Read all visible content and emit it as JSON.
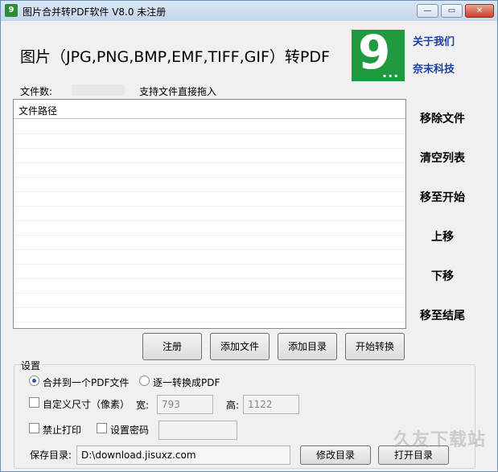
{
  "window": {
    "title": "图片合并转PDF软件 V8.0 未注册",
    "icon_text": "9",
    "controls": {
      "minimize": "—",
      "maximize": "▭",
      "close": "✕"
    }
  },
  "header": {
    "heading": "图片（JPG,PNG,BMP,EMF,TIFF,GIF）转PDF",
    "logo_text": "9",
    "logo_dots": "...",
    "about_link": "关于我们",
    "brand_link": "奈末科技"
  },
  "files": {
    "count_label": "文件数:",
    "count_value": "",
    "drag_hint": "支持文件直接拖入",
    "column_header": "文件路径",
    "rows": []
  },
  "side_actions": {
    "remove": "移除文件",
    "clear": "清空列表",
    "move_top": "移至开始",
    "move_up": "上移",
    "move_down": "下移",
    "move_bottom": "移至结尾"
  },
  "buttons": {
    "register": "注册",
    "add_file": "添加文件",
    "add_dir": "添加目录",
    "start": "开始转换"
  },
  "settings": {
    "title": "设置",
    "merge_option": "合并到一个PDF文件",
    "merge_selected": true,
    "each_option": "逐一转换成PDF",
    "custom_size_label": "自定义尺寸（像素）",
    "width_label": "宽:",
    "width_value": "793",
    "height_label": "高:",
    "height_value": "1122",
    "no_print_label": "禁止打印",
    "password_label": "设置密码",
    "password_value": "",
    "save_dir_label": "保存目录:",
    "save_dir_value": "D:\\download.jisuxz.com",
    "change_dir": "修改目录",
    "open_dir": "打开目录"
  },
  "watermark": "久友下载站"
}
